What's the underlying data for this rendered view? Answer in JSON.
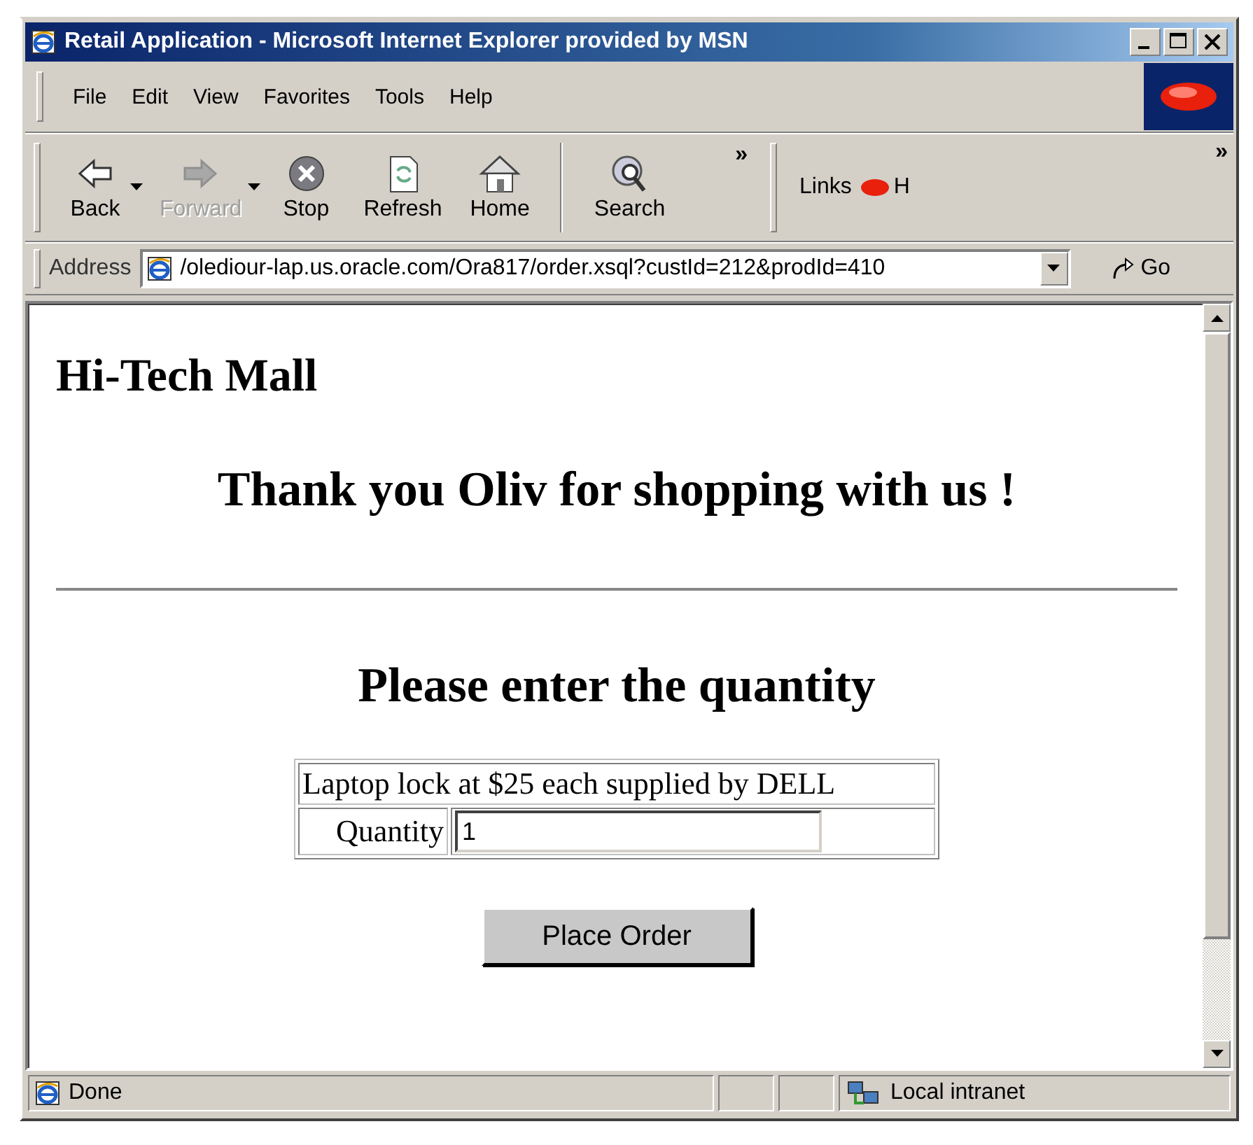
{
  "window": {
    "title": "Retail Application - Microsoft Internet Explorer provided by MSN"
  },
  "menu": [
    "File",
    "Edit",
    "View",
    "Favorites",
    "Tools",
    "Help"
  ],
  "toolbar": {
    "buttons": [
      {
        "label": "Back",
        "disabled": false,
        "dropdown": true
      },
      {
        "label": "Forward",
        "disabled": true,
        "dropdown": true
      },
      {
        "label": "Stop",
        "disabled": false,
        "dropdown": false
      },
      {
        "label": "Refresh",
        "disabled": false,
        "dropdown": false
      },
      {
        "label": "Home",
        "disabled": false,
        "dropdown": false
      },
      {
        "label": "Search",
        "disabled": false,
        "dropdown": false
      }
    ],
    "overflow": "»"
  },
  "links": {
    "label": "Links",
    "items": [
      "H"
    ],
    "overflow": "»"
  },
  "address": {
    "label": "Address",
    "value": "/olediour-lap.us.oracle.com/Ora817/order.xsql?custId=212&prodId=410",
    "go": "Go"
  },
  "page": {
    "site_title": "Hi-Tech Mall",
    "greeting": "Thank you Oliv for shopping with us !",
    "prompt": "Please enter the quantity",
    "product": "Laptop lock at $25 each supplied by DELL",
    "quantity_label": "Quantity",
    "quantity": "1",
    "submit": "Place Order"
  },
  "status_bar": {
    "text": "Done",
    "zone": "Local intranet"
  }
}
